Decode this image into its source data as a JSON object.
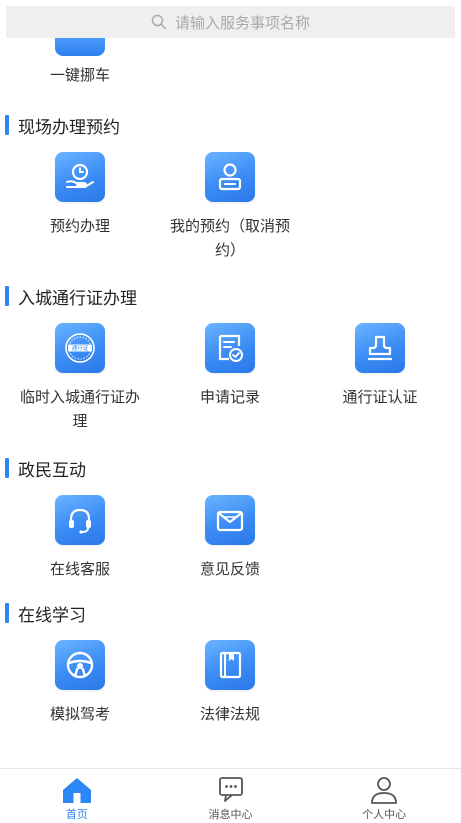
{
  "search": {
    "placeholder": "请输入服务事项名称"
  },
  "partial_item": {
    "label": "一键挪车"
  },
  "sections": [
    {
      "title": "现场办理预约",
      "items": [
        {
          "label": "预约办理",
          "icon": "hand-clock-icon"
        },
        {
          "label": "我的预约（取消预约）",
          "icon": "person-card-icon"
        }
      ]
    },
    {
      "title": "入城通行证办理",
      "items": [
        {
          "label": "临时入城通行证办理",
          "icon": "pass-stamp-icon",
          "stamp_text": "通行证"
        },
        {
          "label": "申请记录",
          "icon": "document-check-icon"
        },
        {
          "label": "通行证认证",
          "icon": "seal-icon"
        }
      ]
    },
    {
      "title": "政民互动",
      "items": [
        {
          "label": "在线客服",
          "icon": "headset-icon"
        },
        {
          "label": "意见反馈",
          "icon": "envelope-icon"
        }
      ]
    },
    {
      "title": "在线学习",
      "items": [
        {
          "label": "模拟驾考",
          "icon": "steering-wheel-icon"
        },
        {
          "label": "法律法规",
          "icon": "book-icon"
        }
      ]
    }
  ],
  "nav": [
    {
      "label": "首页",
      "icon": "home-icon",
      "active": true
    },
    {
      "label": "消息中心",
      "icon": "message-icon",
      "active": false
    },
    {
      "label": "个人中心",
      "icon": "user-icon",
      "active": false
    }
  ],
  "colors": {
    "accent": "#2d86f5",
    "tile_top": "#6ab4ff",
    "tile_bottom": "#2a78e8"
  }
}
